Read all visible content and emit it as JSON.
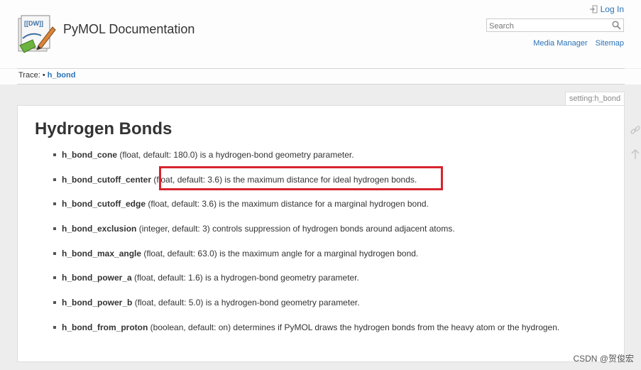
{
  "header": {
    "site_title": "PyMOL Documentation",
    "logo_text": "[[DW]]",
    "login_label": "Log In",
    "search_placeholder": "Search",
    "links": [
      "Media Manager",
      "Sitemap"
    ]
  },
  "breadcrumb": {
    "label": "Trace:",
    "separator": "•",
    "current": "h_bond"
  },
  "page": {
    "tag": "setting:h_bond",
    "title": "Hydrogen Bonds",
    "settings": [
      {
        "name": "h_bond_cone",
        "description": "(float, default: 180.0) is a hydrogen-bond geometry parameter."
      },
      {
        "name": "h_bond_cutoff_center",
        "description": "(float, default: 3.6) is the maximum distance for ideal hydrogen bonds."
      },
      {
        "name": "h_bond_cutoff_edge",
        "description": "(float, default: 3.6) is the maximum distance for a marginal hydrogen bond."
      },
      {
        "name": "h_bond_exclusion",
        "description": "(integer, default: 3) controls suppression of hydrogen bonds around adjacent atoms."
      },
      {
        "name": "h_bond_max_angle",
        "description": "(float, default: 63.0) is the maximum angle for a marginal hydrogen bond."
      },
      {
        "name": "h_bond_power_a",
        "description": "(float, default: 1.6) is a hydrogen-bond geometry parameter."
      },
      {
        "name": "h_bond_power_b",
        "description": "(float, default: 5.0) is a hydrogen-bond geometry parameter."
      },
      {
        "name": "h_bond_from_proton",
        "description": "(boolean, default: on) determines if PyMOL draws the hydrogen bonds from the heavy atom or the hydrogen."
      }
    ]
  },
  "annotation": {
    "highlight_color": "#d7242e"
  },
  "side_icons": [
    "link-icon",
    "arrow-up-icon"
  ],
  "watermark": "CSDN @贺俊宏",
  "colors": {
    "link": "#2b73b7",
    "text": "#333333",
    "background": "#ededed"
  }
}
